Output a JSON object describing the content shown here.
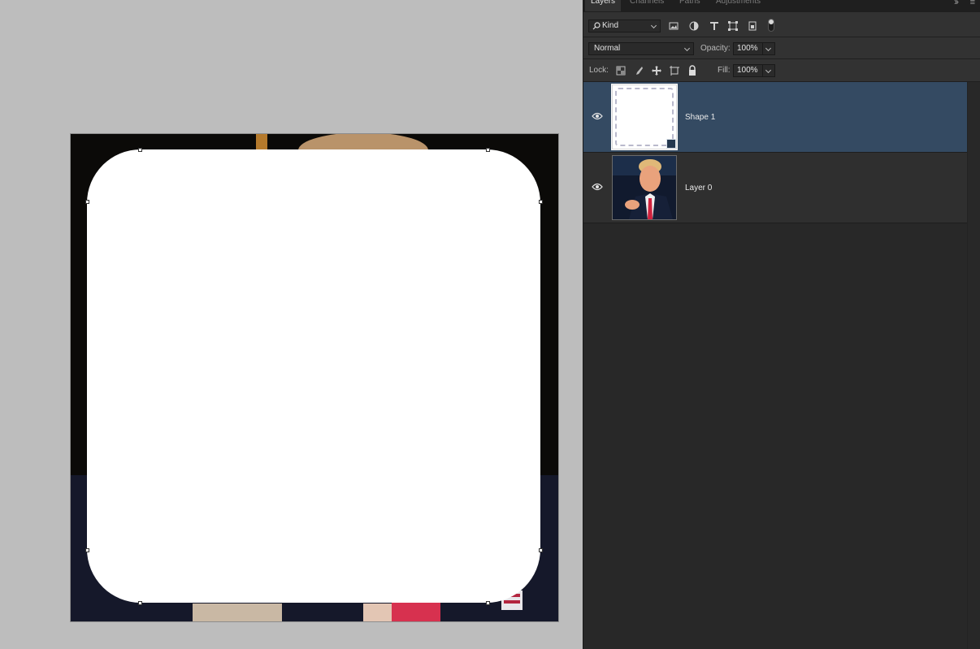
{
  "panel": {
    "tabs": [
      {
        "label": "Layers",
        "active": true
      },
      {
        "label": "Channels",
        "active": false
      },
      {
        "label": "Paths",
        "active": false
      },
      {
        "label": "Adjustments",
        "active": false
      }
    ],
    "filter": {
      "kind_label": "Kind"
    },
    "blend_mode": "Normal",
    "opacity_label": "Opacity:",
    "opacity_value": "100%",
    "lock_label": "Lock:",
    "fill_label": "Fill:",
    "fill_value": "100%",
    "layers": [
      {
        "name": "Shape 1",
        "visible": true,
        "selected": true,
        "type": "shape"
      },
      {
        "name": "Layer 0",
        "visible": true,
        "selected": false,
        "type": "pixel"
      }
    ]
  },
  "canvas": {
    "shape_fill": "#ffffff",
    "document_background": "#0d0c0a"
  },
  "colors": {
    "selected_layer": "#344a62",
    "panel_bg": "#282828",
    "workspace_bg": "#bdbdbd"
  }
}
